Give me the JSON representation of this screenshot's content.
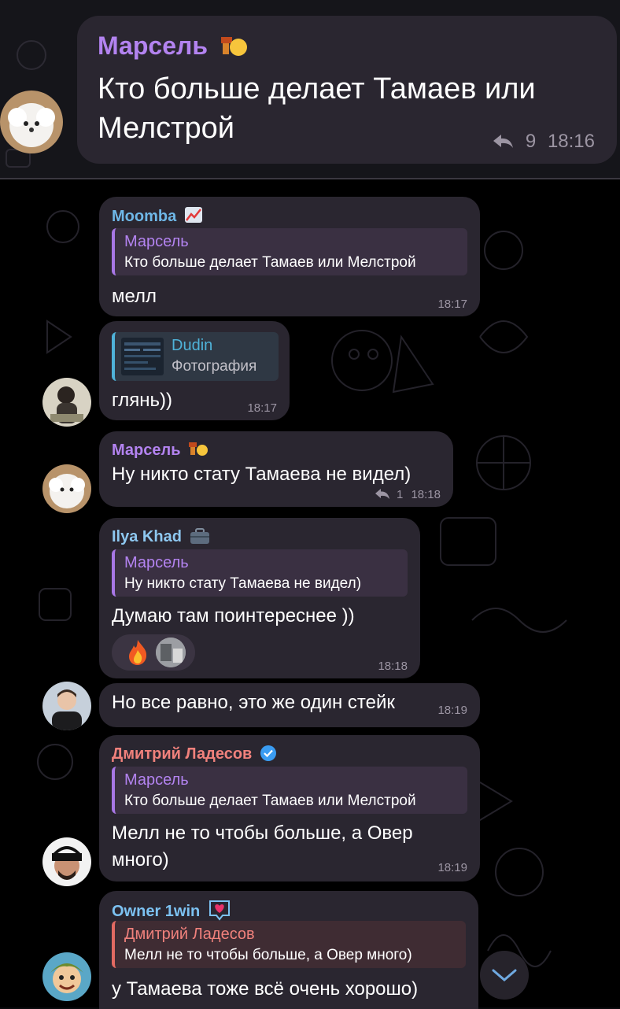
{
  "pinned": {
    "sender": "Марсель",
    "text_line1": "Кто больше делает Тамаев или",
    "text_line2": "Мелстрой",
    "replies": "9",
    "time": "18:16"
  },
  "messages": [
    {
      "sender": "Moomba",
      "reply_name": "Марсель",
      "reply_text": "Кто больше делает Тамаев или Мелстрой",
      "text": "мелл",
      "time": "18:17"
    },
    {
      "reply_name": "Dudin",
      "reply_text": "Фотография",
      "text": "глянь))",
      "time": "18:17"
    },
    {
      "sender": "Марсель",
      "text": "Ну никто стату Тамаева не видел)",
      "replies": "1",
      "time": "18:18"
    },
    {
      "sender": "Ilya Khad",
      "reply_name": "Марсель",
      "reply_text": "Ну никто стату Тамаева не видел)",
      "text": "Думаю там поинтереснее ))",
      "time": "18:18",
      "reaction_icon": "fire-emoji"
    },
    {
      "text": "Но все равно, это же один стейк",
      "time": "18:19"
    },
    {
      "sender": "Дмитрий Ладесов",
      "reply_name": "Марсель",
      "reply_text": "Кто больше делает Тамаев или Мелстрой",
      "text_line1": "Мелл не то чтобы больше, а Овер",
      "text_line2": "много)",
      "time": "18:19"
    },
    {
      "sender": "Owner 1win",
      "reply_name": "Дмитрий Ладесов",
      "reply_text": "Мелл не то чтобы больше, а Овер много)",
      "text": "у Тамаева тоже всё очень хорошо)"
    }
  ],
  "colors": {
    "bubble": "#2a2630",
    "marsel": "#b383f0",
    "moomba": "#6fb8e8",
    "dudin": "#4fb3d9",
    "ilya": "#8ec8f0",
    "dmitry": "#f0817c",
    "owner": "#7cc2f2"
  },
  "icons": [
    "reply-arrow-icon",
    "chart-emoji-icon",
    "briefcase-emoji-icon",
    "verified-icon",
    "heart-emoji-icon",
    "chevron-down-icon"
  ]
}
